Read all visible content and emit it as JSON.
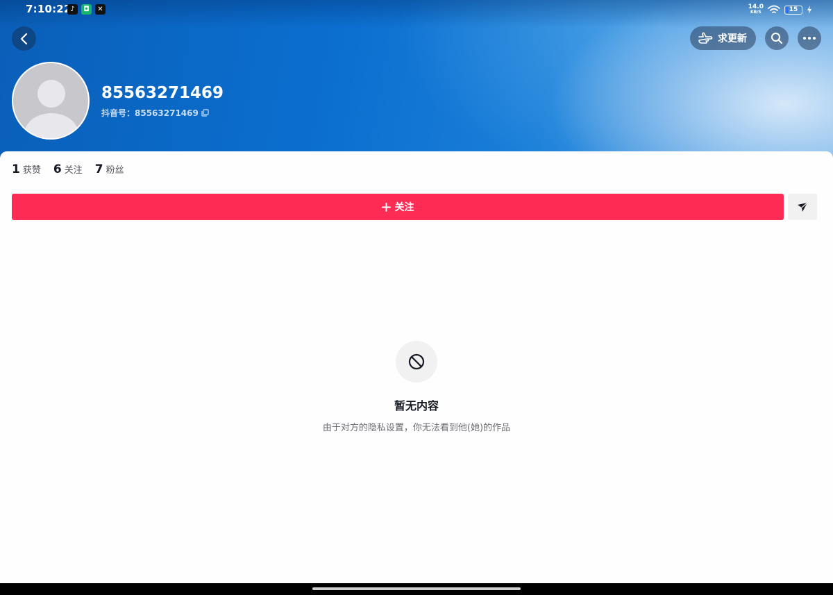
{
  "status_bar": {
    "time": "7:10:22",
    "apps": [
      "tiktok-icon",
      "shield-app-icon",
      "capcut-icon"
    ],
    "net_speed": "14.0",
    "net_unit": "KB/S",
    "battery": "15"
  },
  "header": {
    "update_label": "求更新"
  },
  "profile": {
    "username": "85563271469",
    "douyin_id": "抖音号：85563271469"
  },
  "stats": [
    {
      "num": "1",
      "label": "获赞"
    },
    {
      "num": "6",
      "label": "关注"
    },
    {
      "num": "7",
      "label": "粉丝"
    }
  ],
  "actions": {
    "follow_label": "关注"
  },
  "empty_state": {
    "title": "暂无内容",
    "description": "由于对方的隐私设置，你无法看到他(她)的作品"
  },
  "colors": {
    "follow_accent": "#fe2c55",
    "banner_blue": "#0b6fd0",
    "text_primary": "#161823"
  }
}
